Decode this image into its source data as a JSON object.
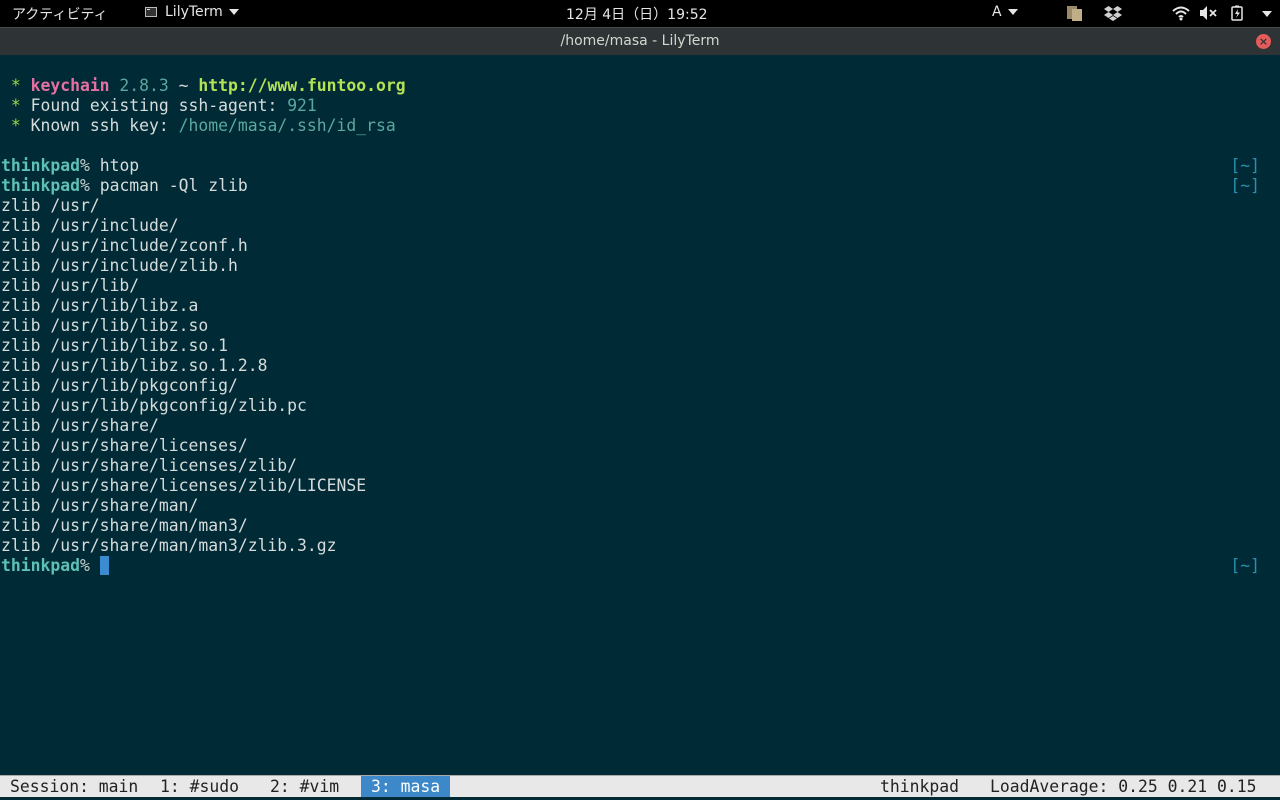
{
  "topbar": {
    "activities": "アクティビティ",
    "app_name": "LilyTerm",
    "clock": "12月 4日（日）19:52",
    "input_method": "A"
  },
  "window": {
    "title": "/home/masa - LilyTerm",
    "close_glyph": "×"
  },
  "terminal": {
    "keychain": {
      "bullet": " * ",
      "name": "keychain",
      "version": " 2.8.3 ",
      "tilde": "~ ",
      "url": "http://www.funtoo.org"
    },
    "agent": {
      "bullet": " * ",
      "label": "Found existing ssh-agent: ",
      "value": "921"
    },
    "known_key": {
      "bullet": " * ",
      "label": "Known ssh key: ",
      "value": "/home/masa/.ssh/id_rsa"
    },
    "prompt": {
      "host": "thinkpad",
      "symbol": "% ",
      "rprompt": "[~]"
    },
    "cmd1": "htop",
    "cmd2": "pacman -Ql zlib",
    "output": [
      "zlib /usr/",
      "zlib /usr/include/",
      "zlib /usr/include/zconf.h",
      "zlib /usr/include/zlib.h",
      "zlib /usr/lib/",
      "zlib /usr/lib/libz.a",
      "zlib /usr/lib/libz.so",
      "zlib /usr/lib/libz.so.1",
      "zlib /usr/lib/libz.so.1.2.8",
      "zlib /usr/lib/pkgconfig/",
      "zlib /usr/lib/pkgconfig/zlib.pc",
      "zlib /usr/share/",
      "zlib /usr/share/licenses/",
      "zlib /usr/share/licenses/zlib/",
      "zlib /usr/share/licenses/zlib/LICENSE",
      "zlib /usr/share/man/",
      "zlib /usr/share/man/man3/",
      "zlib /usr/share/man/man3/zlib.3.gz"
    ]
  },
  "status": {
    "session": "Session: main",
    "win1": "1: #sudo",
    "win2": "2: #vim",
    "win3": "3: masa",
    "host": "thinkpad",
    "load": "LoadAverage: 0.25 0.21 0.15"
  },
  "colors": {
    "terminal_bg": "#002b36",
    "active_window": "#3d88c8",
    "cursor": "#3b8bd1"
  }
}
